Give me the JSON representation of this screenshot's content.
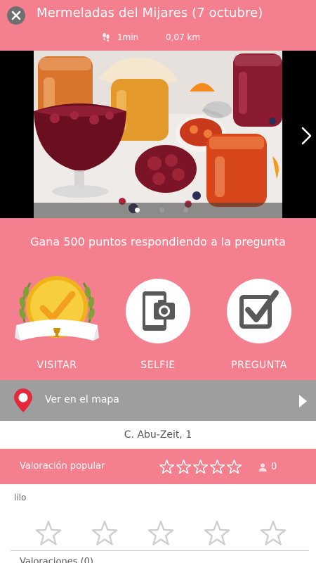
{
  "header": {
    "title": "Mermeladas del Mijares (7 octubre)",
    "time": "1min",
    "distance": "0,07 km",
    "close_icon": "close-icon",
    "walk_icon": "footprints-icon"
  },
  "gallery": {
    "photo_subject": "jam-jars-photo",
    "slide_count": 3,
    "active_slide": 1,
    "next_icon": "chevron-right-icon"
  },
  "reward": {
    "text": "Gana 500 puntos respondiendo a la pregunta",
    "actions": [
      {
        "label": "VISITAR",
        "icon": "visit-badge-icon"
      },
      {
        "label": "SELFIE",
        "icon": "camera-phone-icon"
      },
      {
        "label": "PREGUNTA",
        "icon": "checkbox-icon"
      }
    ]
  },
  "map": {
    "label": "Ver en el mapa",
    "pin_icon": "map-pin-icon",
    "arrow_icon": "play-arrow-icon"
  },
  "address": "C. Abu-Zeit, 1",
  "rating": {
    "label": "Valoración popular",
    "stars_filled": 0,
    "stars_total": 5,
    "count": "0",
    "user_icon": "user-icon"
  },
  "review": {
    "user": "lilo",
    "stars_filled": 0,
    "stars_total": 5,
    "count_label": "Valoraciones (0)"
  },
  "colors": {
    "brand_pink": "#f47f8f",
    "map_bar_gray": "#9e9e9e",
    "pin_red": "#e5273a",
    "gold": "#f5c21b"
  }
}
